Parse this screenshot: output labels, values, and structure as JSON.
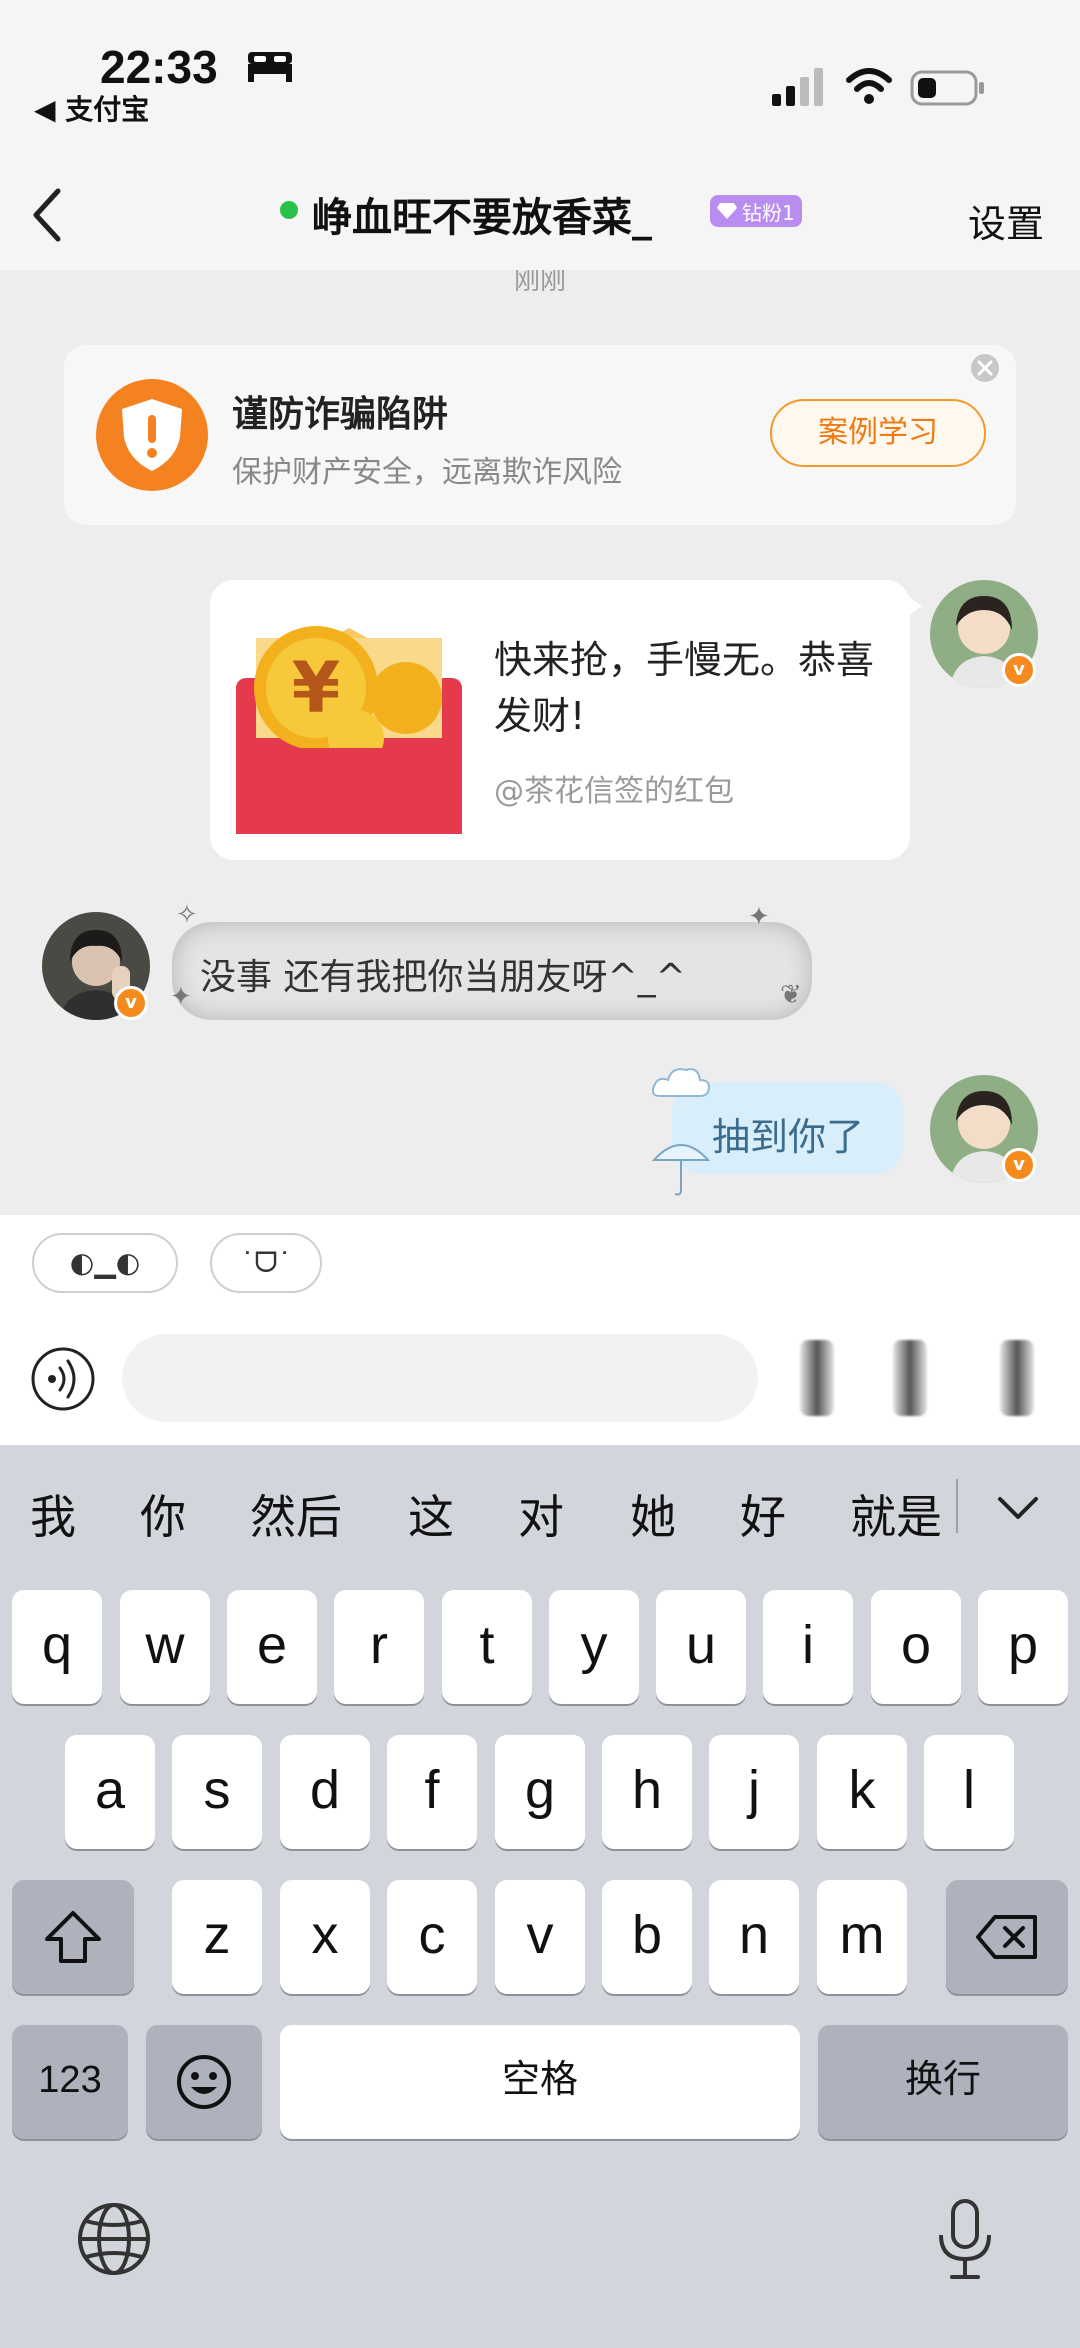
{
  "status_bar": {
    "time": "22:33",
    "back_app": "◀ 支付宝"
  },
  "nav": {
    "title": "峥血旺不要放香菜_",
    "fan_badge": "钻粉1",
    "settings": "设置"
  },
  "chat": {
    "timestamp": "刚刚",
    "warning": {
      "title": "谨防诈骗陷阱",
      "description": "保护财产安全，远离欺诈风险",
      "button": "案例学习"
    },
    "red_packet": {
      "message": "快来抢，手慢无。恭喜发财!",
      "from": "@茶花信签的红包"
    },
    "friend_message": "没事 还有我把你当朋友呀^_^",
    "my_message": "抽到你了"
  },
  "emoticons": [
    "◐▁◐",
    "˙ᗜ˙"
  ],
  "input": {
    "placeholder": ""
  },
  "keyboard": {
    "candidates": [
      "我",
      "你",
      "然后",
      "这",
      "对",
      "她",
      "好",
      "就是"
    ],
    "row1": [
      "q",
      "w",
      "e",
      "r",
      "t",
      "y",
      "u",
      "i",
      "o",
      "p"
    ],
    "row2": [
      "a",
      "s",
      "d",
      "f",
      "g",
      "h",
      "j",
      "k",
      "l"
    ],
    "row3": [
      "z",
      "x",
      "c",
      "v",
      "b",
      "n",
      "m"
    ],
    "numbers": "123",
    "space": "空格",
    "return": "换行"
  },
  "colors": {
    "accent_orange": "#f58220",
    "online_green": "#29c04a",
    "fan_purple": "#b98cf0",
    "my_bubble": "#d8eefb"
  }
}
